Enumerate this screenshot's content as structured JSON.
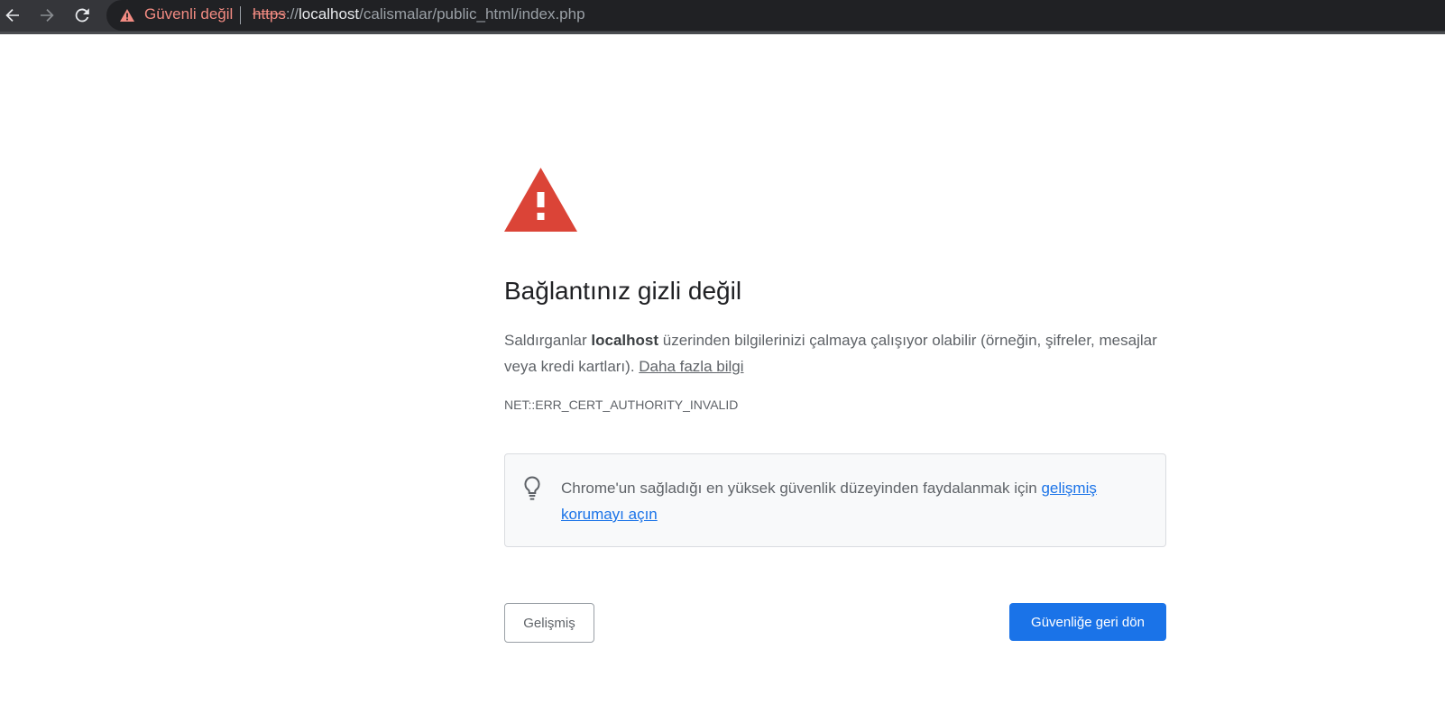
{
  "browser": {
    "security_status": "Güvenli değil",
    "url": {
      "scheme": "https",
      "separator": "://",
      "host": "localhost",
      "path": "/calismalar/public_html/index.php"
    },
    "nav_icons": [
      "back-arrow-icon",
      "forward-arrow-icon",
      "reload-icon"
    ],
    "status_color": "#f28b82"
  },
  "interstitial": {
    "icon": "warning-triangle-icon",
    "icon_color": "#db4437",
    "heading": "Bağlantınız gizli değil",
    "explanation": {
      "prefix": "Saldırganlar ",
      "host": "localhost",
      "suffix": " üzerinden bilgilerinizi çalmaya çalışıyor olabilir (örneğin, şifreler, mesajlar veya kredi kartları). ",
      "learn_more": "Daha fazla bilgi"
    },
    "error_code": "NET::ERR_CERT_AUTHORITY_INVALID",
    "promo": {
      "icon": "lightbulb-icon",
      "text": "Chrome'un sağladığı en yüksek güvenlik düzeyinden faydalanmak için ",
      "link": "gelişmiş korumayı açın"
    },
    "buttons": {
      "advanced": "Gelişmiş",
      "back_to_safety": "Güvenliğe geri dön"
    },
    "accent_color": "#1a73e8"
  }
}
